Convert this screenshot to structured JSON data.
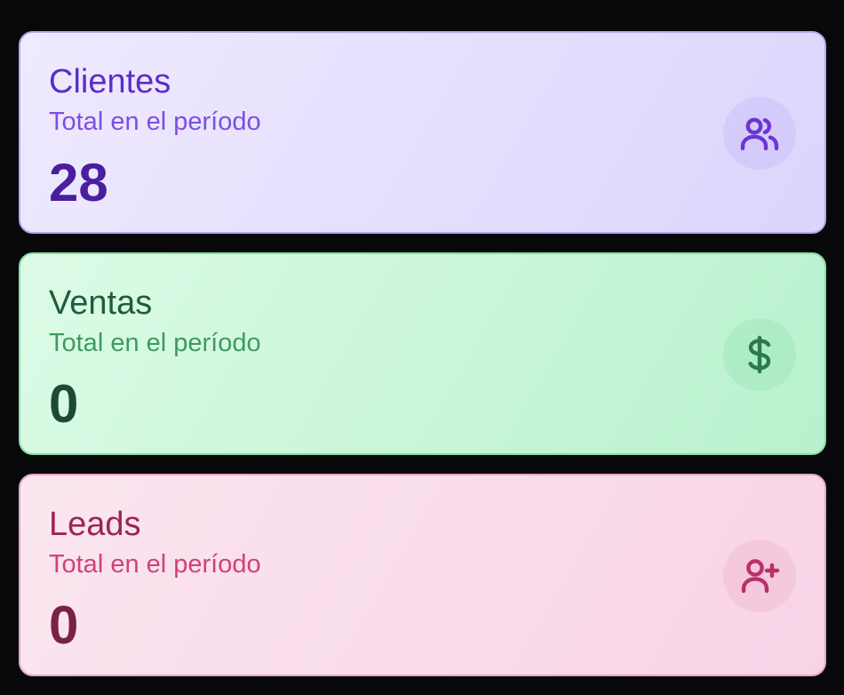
{
  "cards": [
    {
      "title": "Clientes",
      "subtitle": "Total en el período",
      "value": "28",
      "icon": "users-icon",
      "color": "#5b2dc8"
    },
    {
      "title": "Ventas",
      "subtitle": "Total en el período",
      "value": "0",
      "icon": "dollar-icon",
      "color": "#1f5c3b"
    },
    {
      "title": "Leads",
      "subtitle": "Total en el período",
      "value": "0",
      "icon": "user-plus-icon",
      "color": "#9b2555"
    }
  ]
}
